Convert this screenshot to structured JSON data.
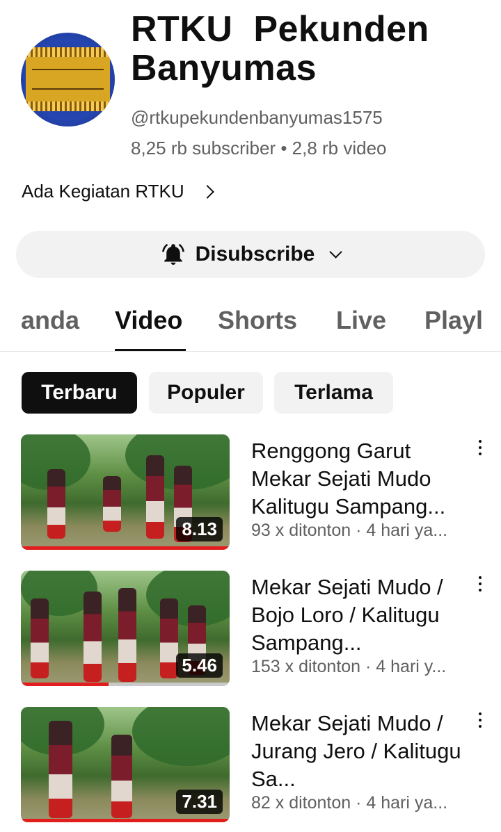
{
  "channel": {
    "name": "RTKU  Pekunden\nBanyumas",
    "handle": "@rtkupekundenbanyumas1575",
    "stats": "8,25 rb subscriber • 2,8 rb video",
    "description_link": "Ada Kegiatan RTKU"
  },
  "subscribe_button": {
    "label": "Disubscribe",
    "icon": "bell-ringing-icon"
  },
  "tabs": [
    {
      "label": "anda",
      "active": false
    },
    {
      "label": "Video",
      "active": true
    },
    {
      "label": "Shorts",
      "active": false
    },
    {
      "label": "Live",
      "active": false
    },
    {
      "label": "Playl",
      "active": false
    }
  ],
  "filters": [
    {
      "label": "Terbaru",
      "active": true
    },
    {
      "label": "Populer",
      "active": false
    },
    {
      "label": "Terlama",
      "active": false
    }
  ],
  "videos": [
    {
      "title": "Renggong Garut Mekar Sejati Mudo Kalitugu Sampang...",
      "meta": "93 x ditonton · 4 hari ya...",
      "duration": "8.13",
      "watched_fraction": 1.0
    },
    {
      "title": "Mekar Sejati Mudo / Bojo Loro / Kalitugu Sampang...",
      "meta": "153 x ditonton · 4 hari y...",
      "duration": "5.46",
      "watched_fraction": 0.42
    },
    {
      "title": "Mekar Sejati Mudo / Jurang Jero / Kalitugu Sa...",
      "meta": "82 x ditonton · 4 hari ya...",
      "duration": "7.31",
      "watched_fraction": 1.0
    }
  ],
  "colors": {
    "accent": "#e11d1d",
    "chip_active": "#0f0f0f",
    "button_bg": "#f2f2f2",
    "secondary_text": "#606060"
  }
}
